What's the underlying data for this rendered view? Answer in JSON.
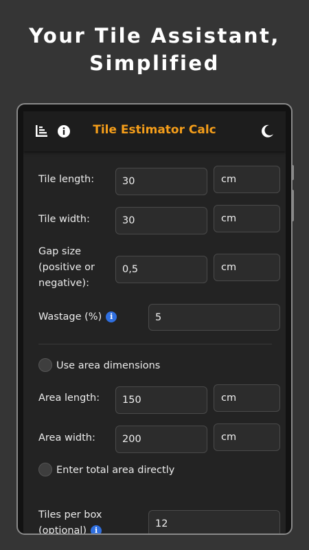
{
  "headline": {
    "line1": "Your Tile Assistant,",
    "line2": "Simplified"
  },
  "appbar": {
    "title": "Tile Estimator Calc",
    "left_icons": [
      "list-chart-icon",
      "info-icon"
    ],
    "right_icon": "moon-icon"
  },
  "form": {
    "tile_length": {
      "label": "Tile length:",
      "value": "30",
      "unit": "cm"
    },
    "tile_width": {
      "label": "Tile width:",
      "value": "30",
      "unit": "cm"
    },
    "gap_size": {
      "label_lines": [
        "Gap size",
        "(positive or",
        "negative):"
      ],
      "value": "0,5",
      "unit": "cm"
    },
    "wastage": {
      "label": "Wastage (%)",
      "value": "5"
    },
    "use_area_dimensions": {
      "label": "Use area dimensions",
      "checked": false
    },
    "area_length": {
      "label": "Area length:",
      "value": "150",
      "unit": "cm"
    },
    "area_width": {
      "label": "Area width:",
      "value": "200",
      "unit": "cm"
    },
    "enter_total_area": {
      "label": "Enter total area directly",
      "checked": false
    },
    "tiles_per_box": {
      "label_lines": [
        "Tiles per box",
        "(optional)"
      ],
      "value": "12"
    }
  },
  "colors": {
    "accent": "#f59e1a",
    "info": "#2f6fe0",
    "background": "#353535",
    "surface": "#232323"
  }
}
